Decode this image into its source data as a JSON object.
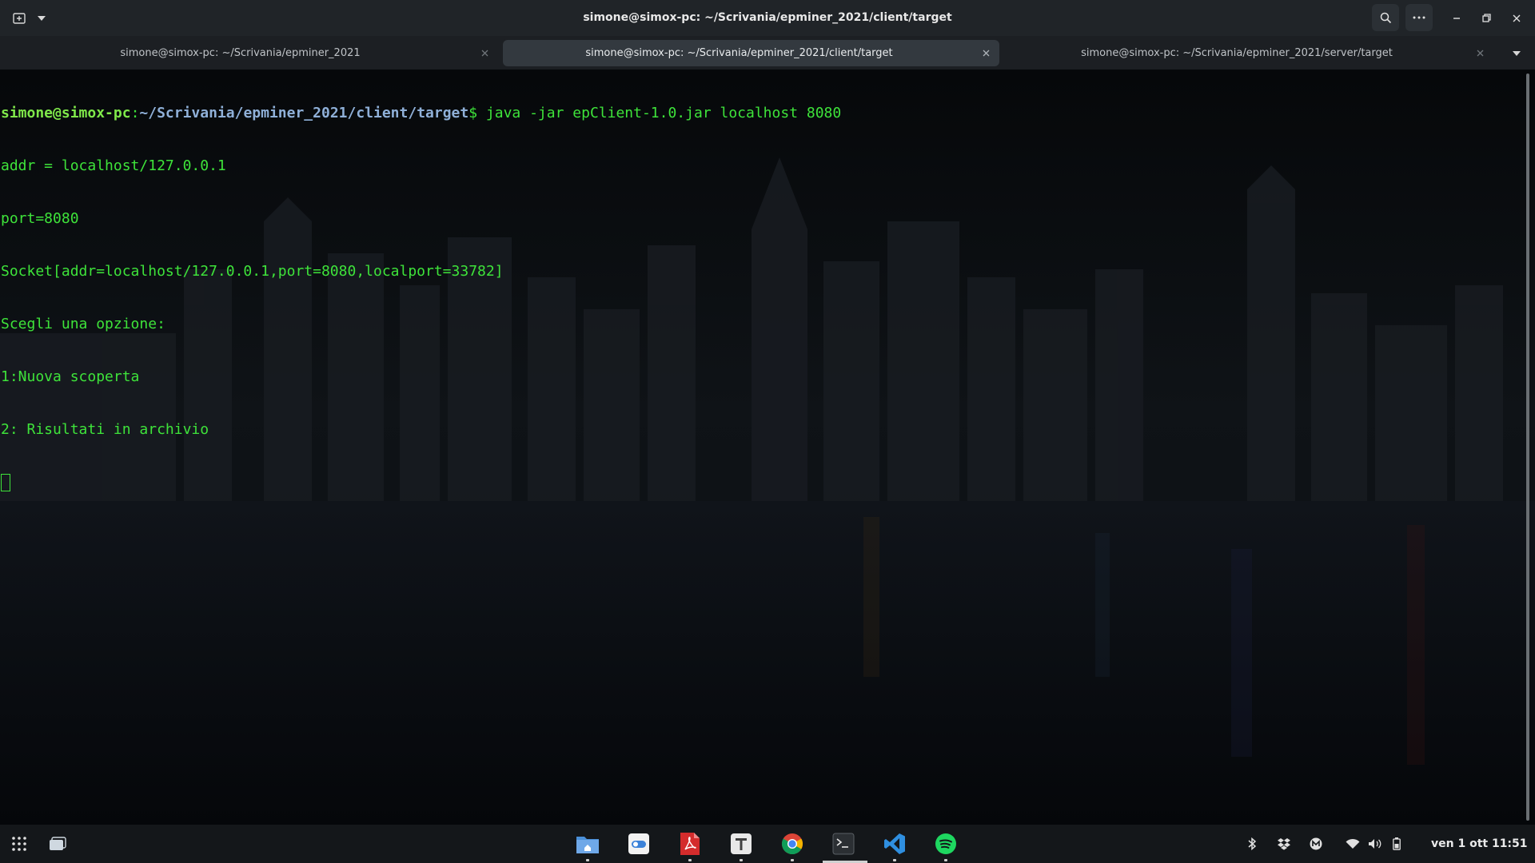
{
  "window": {
    "title": "simone@simox-pc: ~/Scrivania/epminer_2021/client/target"
  },
  "tabs": [
    {
      "label": "simone@simox-pc: ~/Scrivania/epminer_2021",
      "active": false
    },
    {
      "label": "simone@simox-pc: ~/Scrivania/epminer_2021/client/target",
      "active": true
    },
    {
      "label": "simone@simox-pc: ~/Scrivania/epminer_2021/server/target",
      "active": false
    }
  ],
  "terminal": {
    "prompt_user": "simone@simox-pc",
    "prompt_sep": ":",
    "prompt_path": "~/Scrivania/epminer_2021/client/target",
    "prompt_symbol": "$",
    "command": " java -jar epClient-1.0.jar localhost 8080",
    "output": [
      "addr = localhost/127.0.0.1",
      "port=8080",
      "Socket[addr=localhost/127.0.0.1,port=8080,localport=33782]",
      "Scegli una opzione:",
      "1:Nuova scoperta",
      "2: Risultati in archivio"
    ]
  },
  "taskbar": {
    "apps": [
      {
        "name": "files-icon"
      },
      {
        "name": "settings-toggle-icon"
      },
      {
        "name": "pdf-viewer-icon"
      },
      {
        "name": "text-editor-icon"
      },
      {
        "name": "chrome-icon"
      },
      {
        "name": "terminal-icon",
        "active": true
      },
      {
        "name": "vscode-icon"
      },
      {
        "name": "spotify-icon"
      }
    ],
    "tray": [
      "bluetooth-icon",
      "dropbox-icon",
      "m-app-icon",
      "wifi-icon",
      "volume-icon",
      "battery-icon"
    ],
    "clock": "ven 1 ott  11:51"
  },
  "colors": {
    "terminal_text": "#3ee33a",
    "prompt_user": "#7fe84a",
    "prompt_path": "#8fb0d8",
    "headerbar": "#202428"
  }
}
